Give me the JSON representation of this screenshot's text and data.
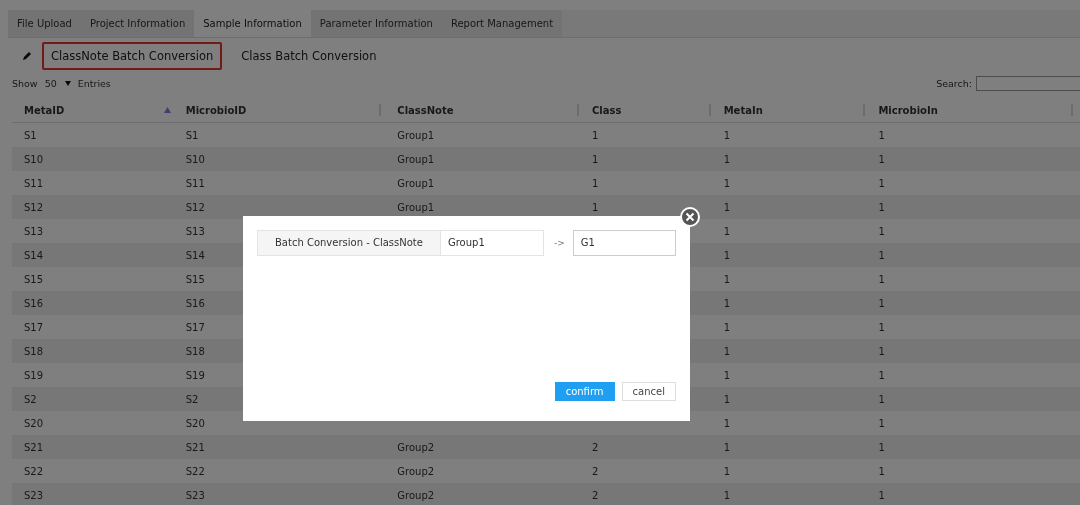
{
  "tabs": [
    {
      "label": "File Upload",
      "selected": false
    },
    {
      "label": "Project Information",
      "selected": false
    },
    {
      "label": "Sample Information",
      "selected": true
    },
    {
      "label": "Parameter Information",
      "selected": false
    },
    {
      "label": "Report Management",
      "selected": false
    }
  ],
  "toolbar": [
    {
      "label": "ClassNote Batch Conversion",
      "highlighted": true
    },
    {
      "label": "Class Batch Conversion",
      "highlighted": false
    }
  ],
  "length_menu": {
    "before": "Show",
    "value": "50",
    "after": "Entries"
  },
  "search": {
    "label": "Search:"
  },
  "table": {
    "columns": [
      {
        "label": "MetaID",
        "sorted": true
      },
      {
        "label": "MicrobioID",
        "sorted": false
      },
      {
        "label": "ClassNote",
        "sorted": false
      },
      {
        "label": "Class",
        "sorted": false
      },
      {
        "label": "MetaIn",
        "sorted": false
      },
      {
        "label": "MicrobioIn",
        "sorted": false
      }
    ],
    "rows": [
      [
        "S1",
        "S1",
        "Group1",
        "1",
        "1",
        "1"
      ],
      [
        "S10",
        "S10",
        "Group1",
        "1",
        "1",
        "1"
      ],
      [
        "S11",
        "S11",
        "Group1",
        "1",
        "1",
        "1"
      ],
      [
        "S12",
        "S12",
        "Group1",
        "1",
        "1",
        "1"
      ],
      [
        "S13",
        "S13",
        null,
        null,
        "1",
        "1"
      ],
      [
        "S14",
        "S14",
        null,
        null,
        "1",
        "1"
      ],
      [
        "S15",
        "S15",
        null,
        null,
        "1",
        "1"
      ],
      [
        "S16",
        "S16",
        null,
        null,
        "1",
        "1"
      ],
      [
        "S17",
        "S17",
        null,
        null,
        "1",
        "1"
      ],
      [
        "S18",
        "S18",
        null,
        null,
        "1",
        "1"
      ],
      [
        "S19",
        "S19",
        null,
        null,
        "1",
        "1"
      ],
      [
        "S2",
        "S2",
        null,
        null,
        "1",
        "1"
      ],
      [
        "S20",
        "S20",
        null,
        null,
        "1",
        "1"
      ],
      [
        "S21",
        "S21",
        "Group2",
        "2",
        "1",
        "1"
      ],
      [
        "S22",
        "S22",
        "Group2",
        "2",
        "1",
        "1"
      ],
      [
        "S23",
        "S23",
        "Group2",
        "2",
        "1",
        "1"
      ]
    ]
  },
  "dialog": {
    "addon": "Batch Conversion - ClassNote",
    "from": "Group1",
    "arrow": "->",
    "to": "G1",
    "buttons": [
      {
        "label": "confirm",
        "kind": "primary"
      },
      {
        "label": "cancel",
        "kind": "default"
      }
    ]
  }
}
